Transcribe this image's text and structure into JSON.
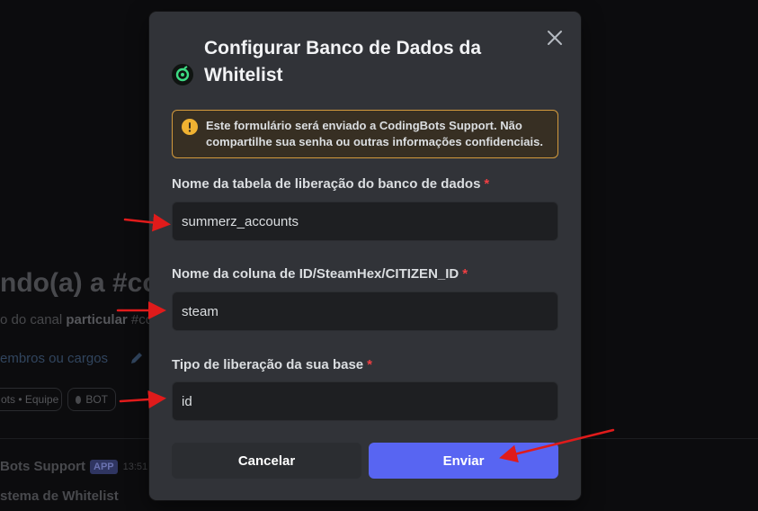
{
  "background": {
    "welcome_text": "ndo(a) a #co",
    "desc_prefix": "o do canal ",
    "desc_bold": "particular",
    "desc_suffix": " #co",
    "members_link": "embros ou cargos",
    "chip_team": "ots • Equipe",
    "chip_bot": "BOT",
    "author": "Bots Support",
    "app_badge": "APP",
    "timestamp": "13:51",
    "message_line": "stema de Whitelist"
  },
  "modal": {
    "title": "Configurar Banco de Dados da Whitelist",
    "warning": "Este formulário será enviado a CodingBots Support. Não compartilhe sua senha ou outras informações confidenciais.",
    "fields": [
      {
        "label": "Nome da tabela de liberação do banco de dados",
        "required": "*",
        "value": "summerz_accounts"
      },
      {
        "label": "Nome da coluna de ID/SteamHex/CITIZEN_ID",
        "required": "*",
        "value": "steam"
      },
      {
        "label": "Tipo de liberação da sua base",
        "required": "*",
        "value": "id"
      }
    ],
    "cancel_label": "Cancelar",
    "submit_label": "Enviar"
  },
  "colors": {
    "modal_bg": "#313338",
    "input_bg": "#1e1f22",
    "accent": "#5865f2",
    "warning_border": "#d39a3d",
    "required": "#f23f43",
    "annotation_arrow": "#e01b1b"
  },
  "icons": [
    "app-icon",
    "close-icon",
    "warning-icon",
    "pencil-icon",
    "arrow-annotation"
  ]
}
